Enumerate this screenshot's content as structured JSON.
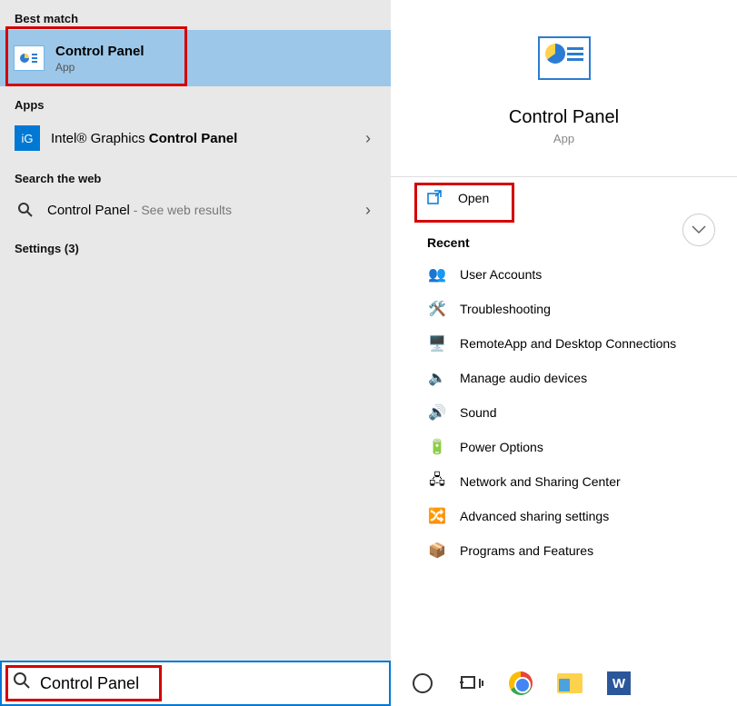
{
  "left": {
    "best_match_head": "Best match",
    "best_match": {
      "title": "Control Panel",
      "subtitle": "App"
    },
    "apps_head": "Apps",
    "apps_item_prefix": "Intel® Graphics ",
    "apps_item_bold": "Control Panel",
    "web_head": "Search the web",
    "web_item": "Control Panel",
    "web_hint": " - See web results",
    "settings_head": "Settings (3)"
  },
  "right": {
    "title": "Control Panel",
    "subtitle": "App",
    "open_label": "Open",
    "recent_head": "Recent",
    "recent": [
      "User Accounts",
      "Troubleshooting",
      "RemoteApp and Desktop Connections",
      "Manage audio devices",
      "Sound",
      "Power Options",
      "Network and Sharing Center",
      "Advanced sharing settings",
      "Programs and Features"
    ],
    "recent_icons": [
      "👥",
      "🛠️",
      "🖥️",
      "🔈",
      "🔊",
      "🔋",
      "🖧",
      "🔀",
      "📦"
    ]
  },
  "search": {
    "value": "Control Panel"
  },
  "annotations": [
    "best-match",
    "open",
    "searchbox"
  ]
}
